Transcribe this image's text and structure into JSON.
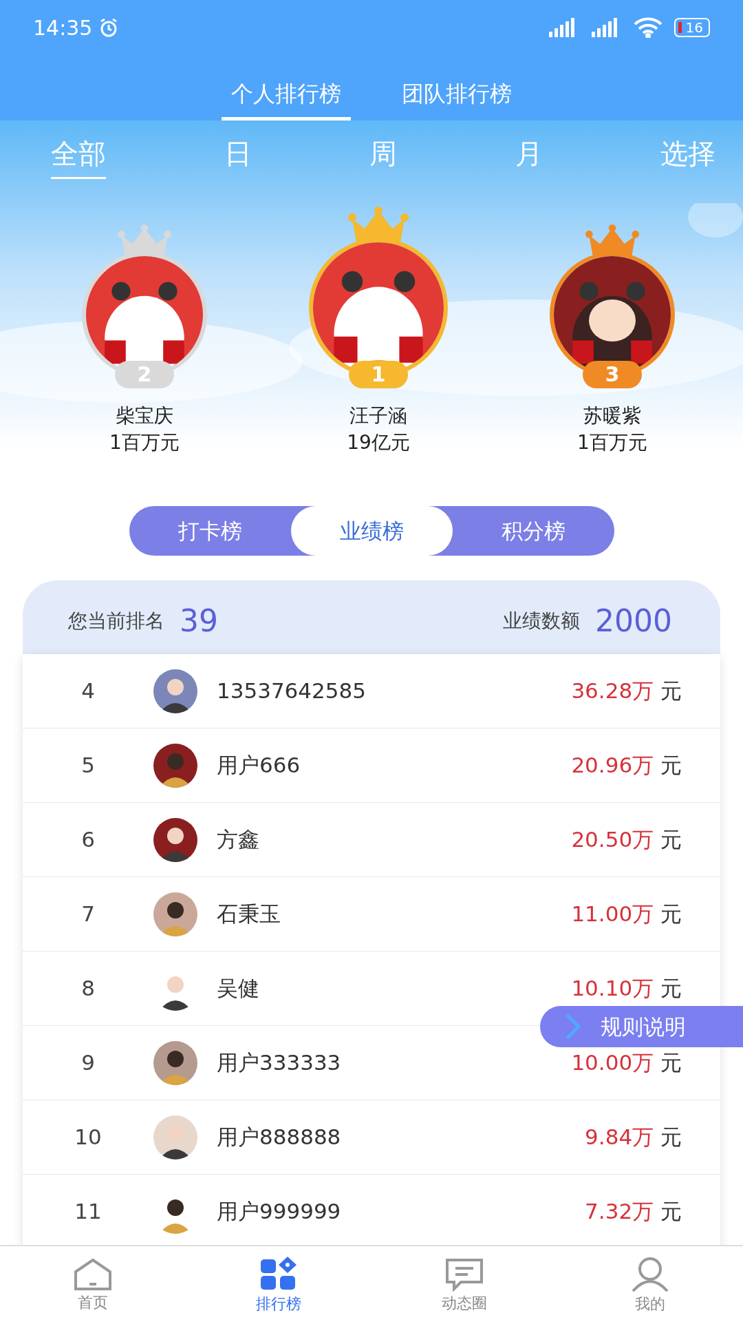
{
  "status_bar": {
    "time": "14:35",
    "battery": "16"
  },
  "top_tabs": [
    {
      "label": "个人排行榜",
      "selected": true
    },
    {
      "label": "团队排行榜",
      "selected": false
    }
  ],
  "period_tabs": [
    {
      "label": "全部",
      "selected": true
    },
    {
      "label": "日",
      "selected": false
    },
    {
      "label": "周",
      "selected": false
    },
    {
      "label": "月",
      "selected": false
    },
    {
      "label": "选择",
      "selected": false
    }
  ],
  "podium": [
    {
      "rank": "2",
      "name": "柴宝庆",
      "amount": "1百万元",
      "color": "#d9d9d9"
    },
    {
      "rank": "1",
      "name": "汪子涵",
      "amount": "19亿元",
      "color": "#f5b82e"
    },
    {
      "rank": "3",
      "name": "苏暖紫",
      "amount": "1百万元",
      "color": "#f08a24"
    }
  ],
  "board_tabs": [
    {
      "label": "打卡榜",
      "selected": false
    },
    {
      "label": "业绩榜",
      "selected": true
    },
    {
      "label": "积分榜",
      "selected": false
    }
  ],
  "summary": {
    "rank_label": "您当前排名",
    "rank": "39",
    "amount_label": "业绩数额",
    "amount": "2000"
  },
  "rows": [
    {
      "rank": "4",
      "name": "13537642585",
      "amount": "36.28万",
      "unit": "元"
    },
    {
      "rank": "5",
      "name": "用户666",
      "amount": "20.96万",
      "unit": "元"
    },
    {
      "rank": "6",
      "name": "方鑫",
      "amount": "20.50万",
      "unit": "元"
    },
    {
      "rank": "7",
      "name": "石秉玉",
      "amount": "11.00万",
      "unit": "元"
    },
    {
      "rank": "8",
      "name": "吴健",
      "amount": "10.10万",
      "unit": "元"
    },
    {
      "rank": "9",
      "name": "用户333333",
      "amount": "10.00万",
      "unit": "元"
    },
    {
      "rank": "10",
      "name": "用户888888",
      "amount": "9.84万",
      "unit": "元"
    },
    {
      "rank": "11",
      "name": "用户999999",
      "amount": "7.32万",
      "unit": "元"
    }
  ],
  "float_button": {
    "label": "规则说明"
  },
  "bottom_nav": [
    {
      "label": "首页",
      "selected": false
    },
    {
      "label": "排行榜",
      "selected": true
    },
    {
      "label": "动态圈",
      "selected": false
    },
    {
      "label": "我的",
      "selected": false
    }
  ]
}
